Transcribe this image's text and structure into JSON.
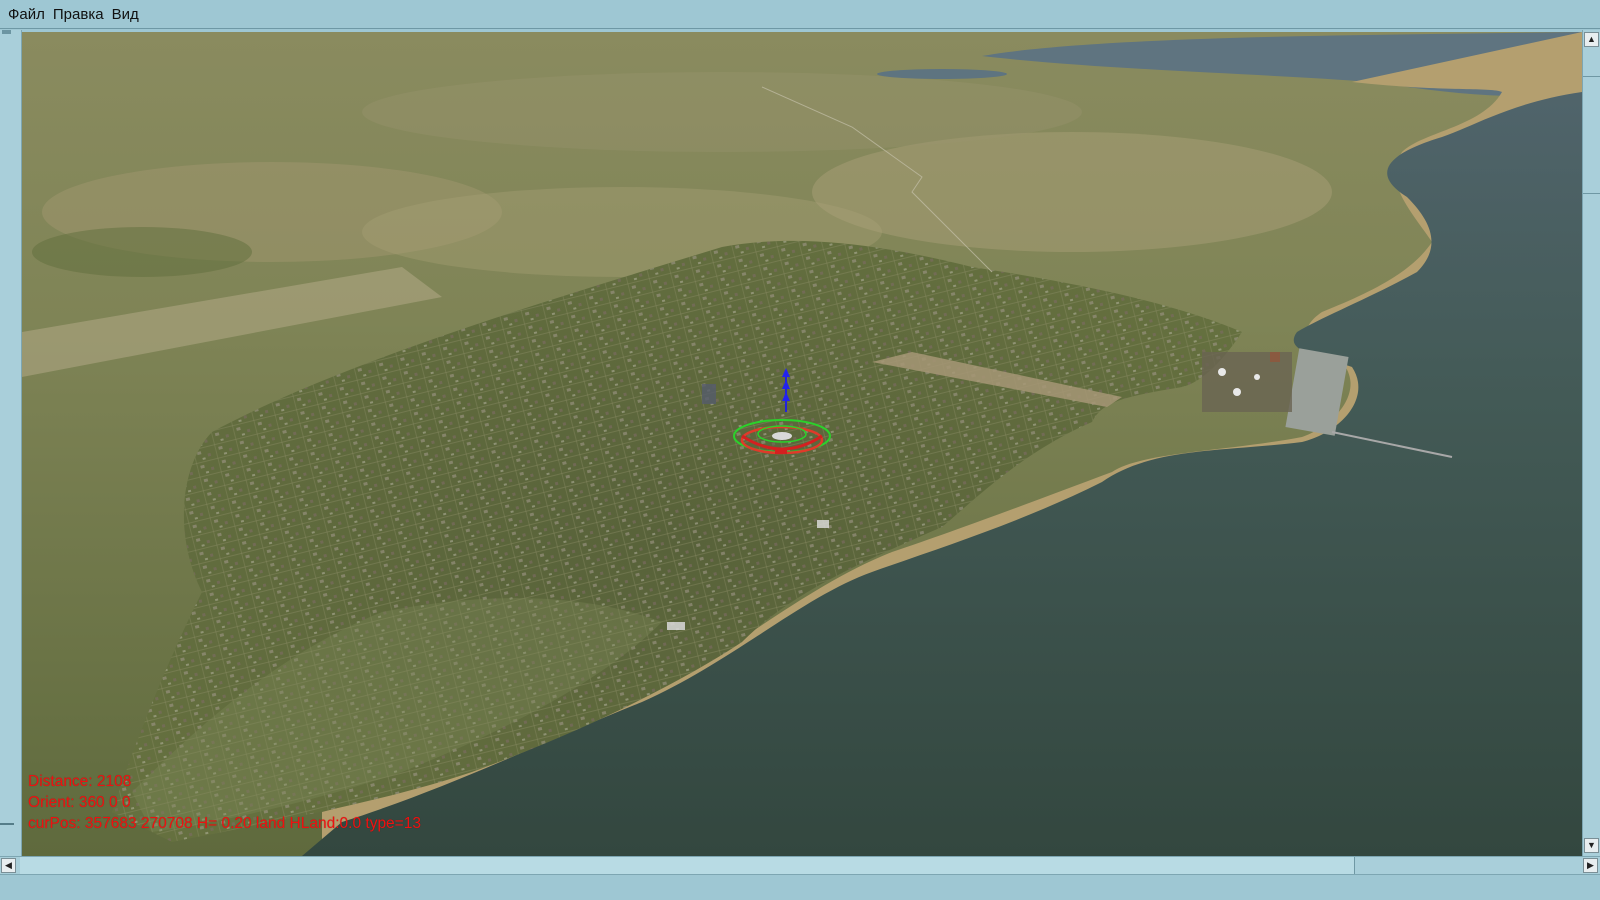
{
  "menu": {
    "items": [
      {
        "label": "Файл"
      },
      {
        "label": "Правка"
      },
      {
        "label": "Вид"
      }
    ]
  },
  "hud": {
    "distance": "Distance: 2108",
    "orient": "Orient: 360 0 0",
    "cur_pos": "curPos: 357683 270708 H= 0.20 land HLand:0.0 type=13"
  },
  "scrollbars": {
    "up_arrow": "▲",
    "down_arrow": "▼",
    "left_arrow": "◀",
    "right_arrow": "▶"
  },
  "colors": {
    "hud_text": "#f01010",
    "chrome": "#9ec7d3",
    "sea": "#3b4f44",
    "beach": "#b09a6a"
  }
}
